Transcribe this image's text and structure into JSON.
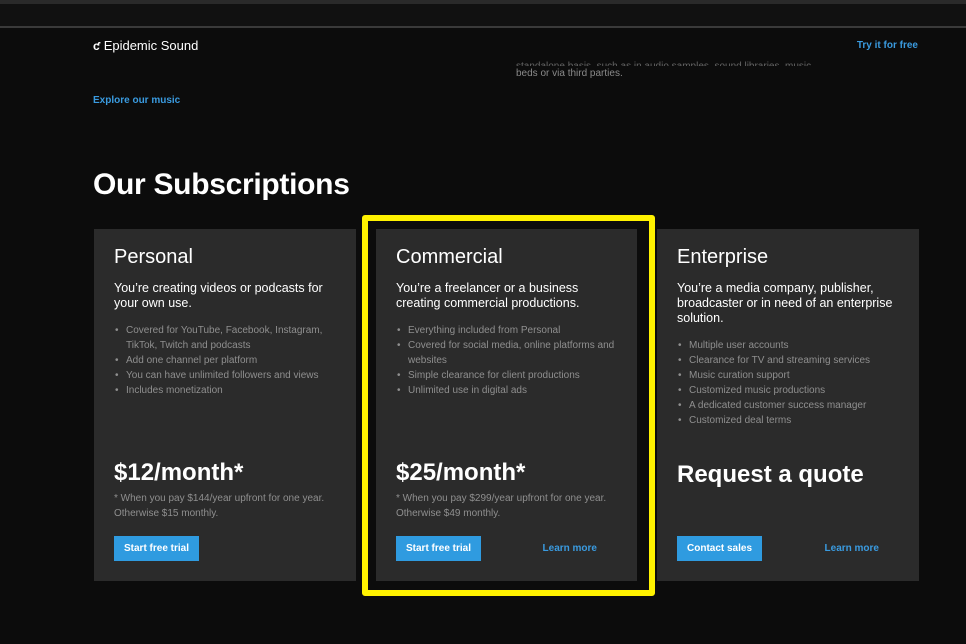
{
  "header": {
    "logo_mark": "ƈ",
    "logo_text": "Epidemic Sound",
    "try_link": "Try it for free",
    "explore_link": "Explore our music",
    "faded_line1": "standalone basis, such as in audio samples, sound libraries, music",
    "faded_line2": "beds or via third parties."
  },
  "section": {
    "title": "Our Subscriptions"
  },
  "cards": [
    {
      "title": "Personal",
      "desc": "You’re creating videos or podcasts for your own use.",
      "features": [
        "Covered for YouTube, Facebook, Instagram, TikTok, Twitch and podcasts",
        "Add one channel per platform",
        "You can have unlimited followers and views",
        "Includes monetization"
      ],
      "price": "$12/month*",
      "note": "* When you pay $144/year upfront for one year. Otherwise $15 monthly.",
      "button": "Start free trial"
    },
    {
      "title": "Commercial",
      "desc": "You’re a freelancer or a business creating commercial productions.",
      "features": [
        "Everything included from Personal",
        "Covered for social media, online platforms and websites",
        "Simple clearance for client productions",
        "Unlimited use in digital ads"
      ],
      "price": "$25/month*",
      "note": "* When you pay $299/year upfront for one year. Otherwise $49 monthly.",
      "button": "Start free trial",
      "learn": "Learn more"
    },
    {
      "title": "Enterprise",
      "desc": "You’re a media company, publisher, broadcaster or in need of an enterprise solution.",
      "features": [
        "Multiple user accounts",
        "Clearance for TV and streaming services",
        "Music curation support",
        "Customized music productions",
        "A dedicated customer success manager",
        "Customized deal terms"
      ],
      "quote": "Request a quote",
      "button": "Contact sales",
      "learn": "Learn more"
    }
  ],
  "colors": {
    "accent": "#2f9be0",
    "highlight": "#fff200",
    "card_bg": "#2b2b2b"
  }
}
